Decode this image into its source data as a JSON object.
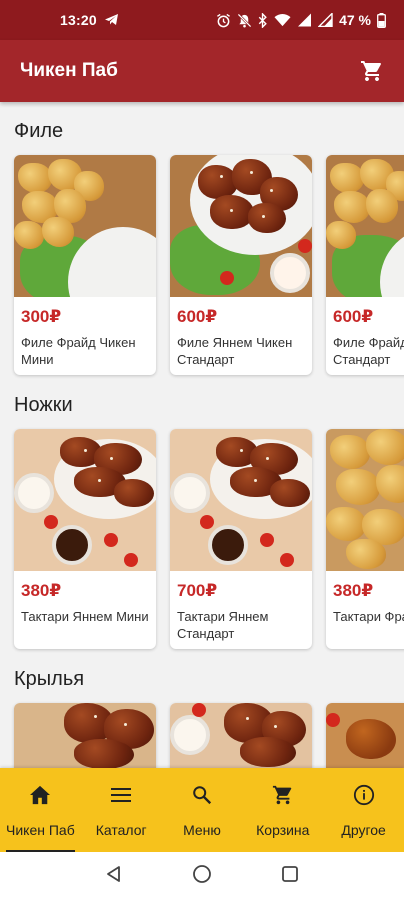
{
  "status_bar": {
    "time": "13:20",
    "battery": "47 %"
  },
  "app_bar": {
    "title": "Чикен Паб"
  },
  "sections": [
    {
      "title": "Филе",
      "items": [
        {
          "price": "300₽",
          "name": "Филе Фрайд Чикен Мини"
        },
        {
          "price": "600₽",
          "name": "Филе Яннем Чикен Стандарт"
        },
        {
          "price": "600₽",
          "name": "Филе Фрайд Чикен Стандарт"
        }
      ]
    },
    {
      "title": "Ножки",
      "items": [
        {
          "price": "380₽",
          "name": "Тактари Яннем Мини"
        },
        {
          "price": "700₽",
          "name": "Тактари Яннем Стандарт"
        },
        {
          "price": "380₽",
          "name": "Тактари Фрайд Мини"
        }
      ]
    },
    {
      "title": "Крылья",
      "items": [
        {},
        {},
        {}
      ]
    }
  ],
  "bottom_nav": [
    {
      "label": "Чикен Паб",
      "icon": "home-icon",
      "active": true
    },
    {
      "label": "Каталог",
      "icon": "menu-lines-icon"
    },
    {
      "label": "Меню",
      "icon": "search-icon"
    },
    {
      "label": "Корзина",
      "icon": "cart-icon"
    },
    {
      "label": "Другое",
      "icon": "info-icon"
    }
  ],
  "colors": {
    "status_bar": "#8e1a1e",
    "app_bar": "#a3262a",
    "price": "#c62828",
    "bottom_nav": "#f6c21c"
  }
}
